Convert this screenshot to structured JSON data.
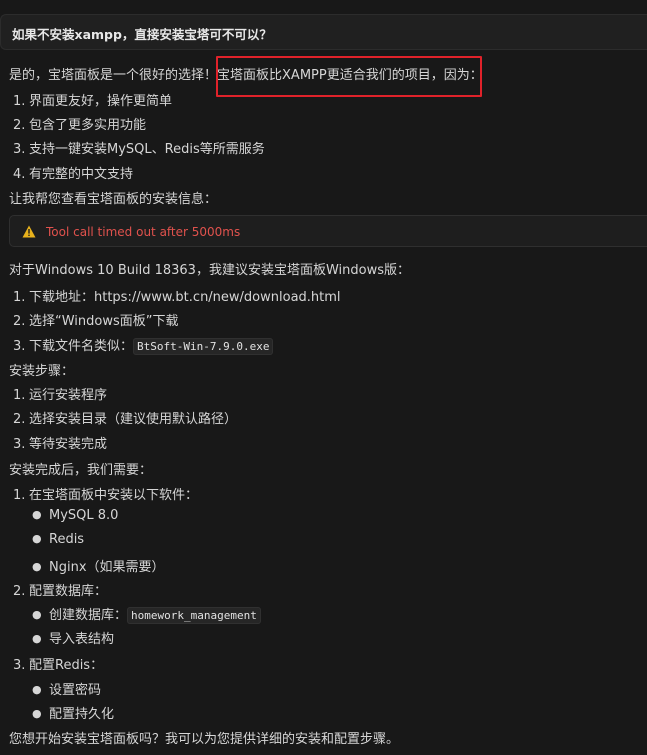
{
  "user_message": "如果不安装xampp，直接安装宝塔可不可以？",
  "intro": {
    "prefix": "是的，宝塔面板是一个很好的选择！",
    "highlight": "宝塔面板比XAMPP更适合我们的项目，因为："
  },
  "reasons": [
    {
      "num": "1.",
      "text": "界面更友好，操作更简单"
    },
    {
      "num": "2.",
      "text": "包含了更多实用功能"
    },
    {
      "num": "3.",
      "text": "支持一键安装MySQL、Redis等所需服务"
    },
    {
      "num": "4.",
      "text": "有完整的中文支持"
    }
  ],
  "check_info": "让我帮您查看宝塔面板的安装信息：",
  "tool_call": {
    "icon": "warning-icon",
    "status": "Tool call timed out after 5000ms",
    "status_color": "#e0524d"
  },
  "recommend": "对于Windows 10 Build 18363，我建议安装宝塔面板Windows版：",
  "download": [
    {
      "num": "1.",
      "text": "下载地址：https://www.bt.cn/new/download.html"
    },
    {
      "num": "2.",
      "text": "选择“Windows面板”下载"
    },
    {
      "num": "3.",
      "text": "下载文件名类似：",
      "code": "BtSoft-Win-7.9.0.exe"
    }
  ],
  "install_title": "安装步骤：",
  "install_steps": [
    {
      "num": "1.",
      "text": "运行安装程序"
    },
    {
      "num": "2.",
      "text": "选择安装目录（建议使用默认路径）"
    },
    {
      "num": "3.",
      "text": "等待安装完成"
    }
  ],
  "after_title": "安装完成后，我们需要：",
  "after_steps": {
    "s1": {
      "num": "1.",
      "text": "在宝塔面板中安装以下软件：",
      "items": [
        "MySQL 8.0",
        "Redis",
        "Nginx（如果需要）"
      ]
    },
    "s2": {
      "num": "2.",
      "text": "配置数据库：",
      "items": [
        "创建数据库：",
        "导入表结构"
      ],
      "code": "homework_management"
    },
    "s3": {
      "num": "3.",
      "text": "配置Redis：",
      "items": [
        "设置密码",
        "配置持久化"
      ]
    }
  },
  "closing": "您想开始安装宝塔面板吗？我可以为您提供详细的安装和配置步骤。",
  "bullet_glyph": "●"
}
